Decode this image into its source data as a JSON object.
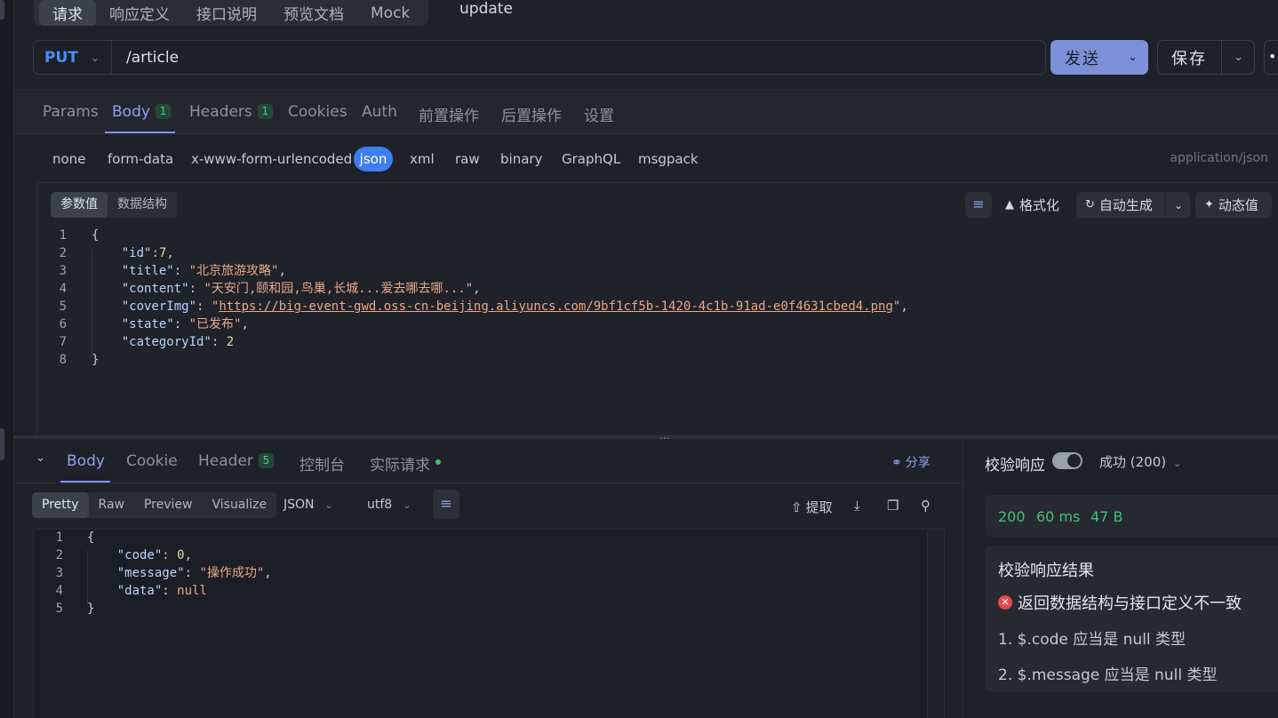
{
  "top_tabs": [
    "请求",
    "响应定义",
    "接口说明",
    "预览文档",
    "Mock"
  ],
  "api_name": "update",
  "request": {
    "method": "PUT",
    "path": "/article",
    "send_label": "发送",
    "save_label": "保存"
  },
  "req_tabs": {
    "params": "Params",
    "body": "Body",
    "body_count": "1",
    "headers": "Headers",
    "headers_count": "1",
    "cookies": "Cookies",
    "auth": "Auth",
    "pre": "前置操作",
    "post": "后置操作",
    "settings": "设置"
  },
  "body_types": [
    "none",
    "form-data",
    "x-www-form-urlencoded",
    "json",
    "xml",
    "raw",
    "binary",
    "GraphQL",
    "msgpack"
  ],
  "content_type": "application/json",
  "editor": {
    "seg_values": "参数值",
    "seg_schema": "数据结构",
    "format_label": "格式化",
    "autogen_label": "自动生成",
    "dynamic_label": "动态值"
  },
  "request_body": {
    "id": "7",
    "title": "\"北京旅游攻略\"",
    "content": "\"天安门,颐和园,鸟巢,长城...爱去哪去哪...\"",
    "coverImg": "https://big-event-gwd.oss-cn-beijing.aliyuncs.com/9bf1cf5b-1420-4c1b-91ad-e0f4631cbed4.png",
    "state": "\"已发布\"",
    "categoryId": "2"
  },
  "resp_tabs": {
    "body": "Body",
    "cookie": "Cookie",
    "header": "Header",
    "header_count": "5",
    "console": "控制台",
    "actual": "实际请求",
    "share": "分享"
  },
  "resp_toolbar": {
    "modes": [
      "Pretty",
      "Raw",
      "Preview",
      "Visualize"
    ],
    "format": "JSON",
    "encoding": "utf8",
    "extract": "提取"
  },
  "response_body": {
    "code": "0",
    "message": "\"操作成功\"",
    "data": "null"
  },
  "validation": {
    "title": "校验响应",
    "status": "成功 (200)",
    "http_code": "200",
    "time": "60 ms",
    "size": "47 B",
    "result_title": "校验响应结果",
    "error_summary": "返回数据结构与接口定义不一致",
    "errors": [
      "1. $.code 应当是 null 类型",
      "2. $.message 应当是 null 类型"
    ]
  },
  "colors": {
    "accent": "#7f95ee",
    "method": "#4b8df7",
    "success": "#44c179",
    "error": "#e24a4a"
  }
}
